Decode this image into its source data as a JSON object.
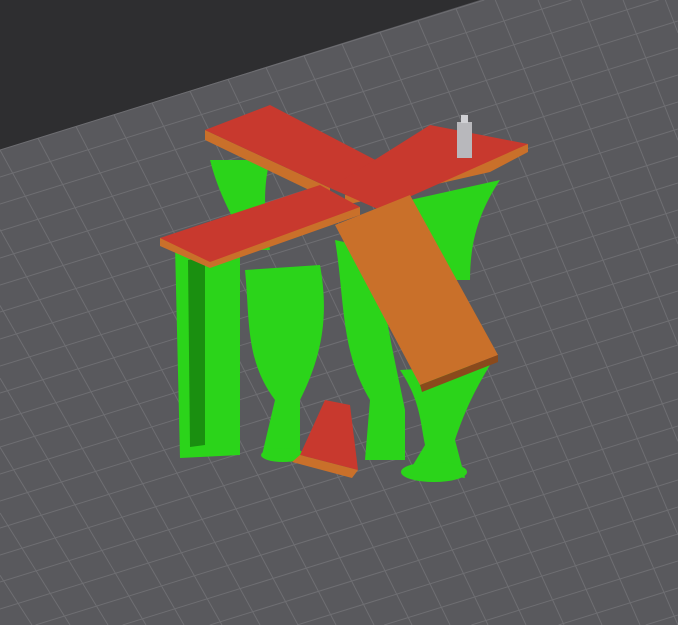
{
  "viewport": {
    "view": "3d-preview",
    "colors": {
      "background": "#2e2e30",
      "bed": "#59595d",
      "grid_line": "#6e6e72",
      "model_top": "#c8392e",
      "model_side": "#c9702a",
      "support": "#2bd41a",
      "support_dark": "#1a8f10",
      "toolhead": "#b8b8bc"
    }
  }
}
